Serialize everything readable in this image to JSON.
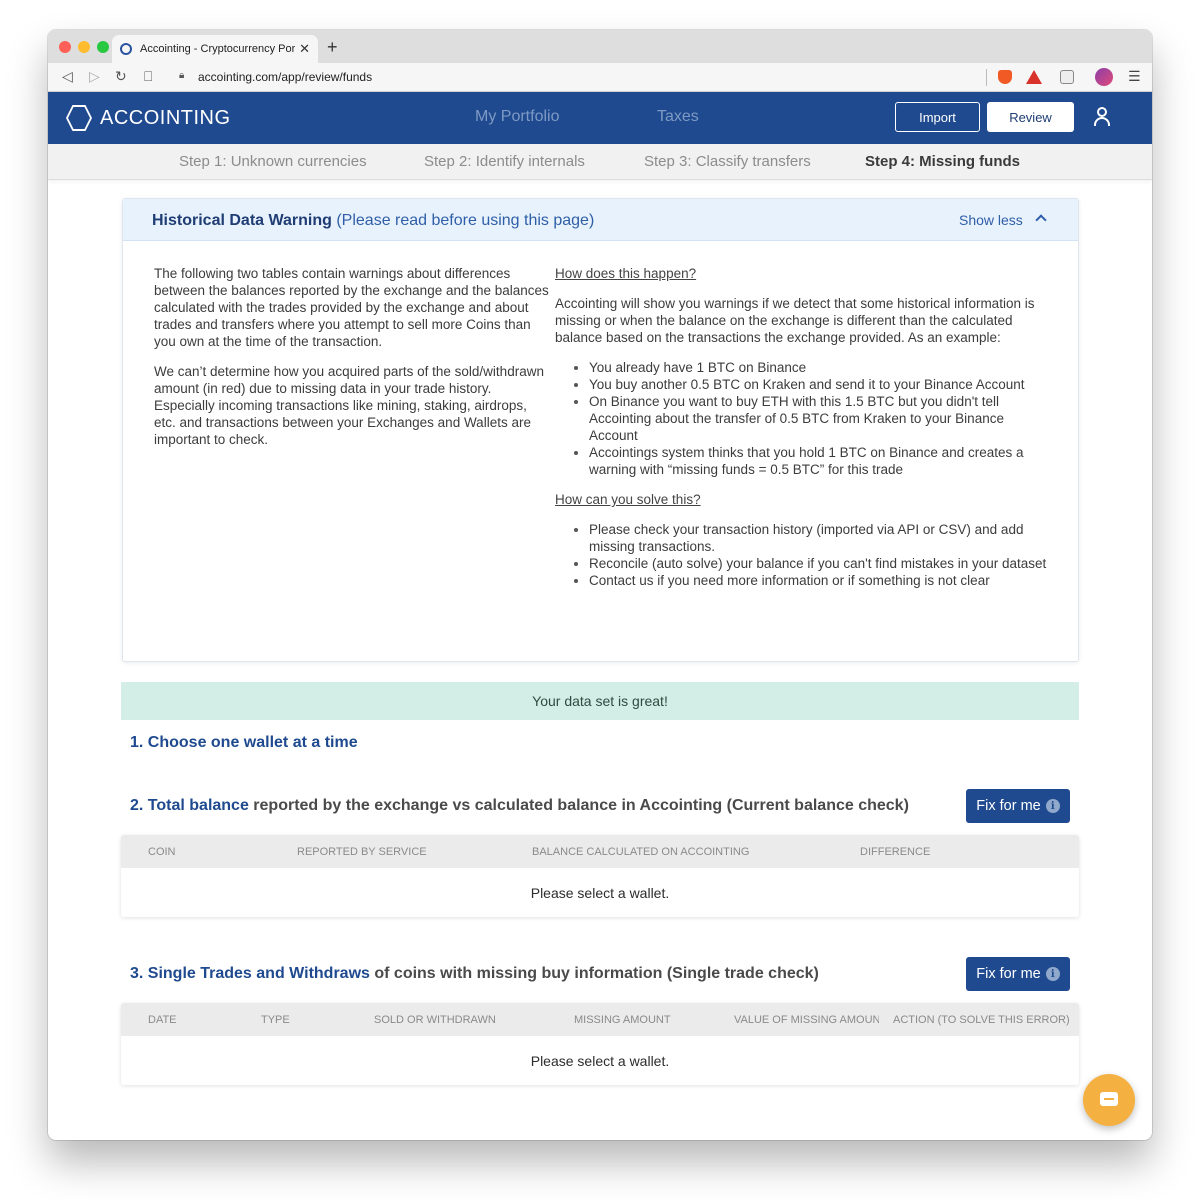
{
  "browser": {
    "tab_title": "Accointing - Cryptocurrency Portfolio",
    "new_tab": "+",
    "url": "accointing.com/app/review/funds"
  },
  "header": {
    "logo_text": "ACCOINTING",
    "nav": [
      "My Portfolio",
      "Taxes"
    ],
    "import_label": "Import",
    "review_label": "Review"
  },
  "steps": [
    "Step 1: Unknown currencies",
    "Step 2: Identify internals",
    "Step 3: Classify transfers",
    "Step 4: Missing funds"
  ],
  "warning": {
    "title": "Historical Data Warning",
    "subtitle": "(Please read before using this page)",
    "toggle_label": "Show less",
    "left_paragraphs": [
      "The following two tables contain warnings about differences between the balances reported by the exchange and the balances calculated with the trades provided by the exchange and about trades and transfers where you attempt to sell more Coins than you own at the time of the transaction.",
      "We can’t determine how you acquired parts of the sold/withdrawn amount (in red) due to missing data in your trade history. Especially incoming transactions like mining, staking, airdrops, etc. and transactions between your Exchanges and Wallets are important to check."
    ],
    "how_heading": "How does this happen?",
    "how_intro": "Accointing will show you warnings if we detect that some historical information is missing or when the balance on the exchange is different than the calculated balance based on the transactions the exchange provided. As an example:",
    "how_bullets": [
      "You already have 1 BTC on Binance",
      "You buy another 0.5 BTC on Kraken and send it to your Binance Account",
      "On Binance you want to buy ETH with this 1.5 BTC but you didn't tell Accointing about the transfer of 0.5 BTC from Kraken to your Binance Account",
      "Accointings system thinks that you hold 1 BTC on Binance and creates a warning with “missing funds = 0.5 BTC” for this trade"
    ],
    "solve_heading": "How can you solve this?",
    "solve_bullets": [
      "Please check your transaction history (imported via API or CSV) and add missing transactions.",
      "Reconcile (auto solve) your balance if you can't find mistakes in your dataset",
      "Contact us if you need more information or if something is not clear"
    ]
  },
  "status_message": "Your data set is great!",
  "section1": {
    "title": "1. Choose one wallet at a time"
  },
  "section2": {
    "title_blue": "2. Total balance",
    "title_rest": " reported by the exchange vs calculated balance in Accointing (Current balance check)",
    "fix_label": "Fix for me",
    "columns": [
      "COIN",
      "REPORTED BY SERVICE",
      "BALANCE CALCULATED ON ACCOINTING",
      "DIFFERENCE"
    ],
    "empty_message": "Please select a wallet."
  },
  "section3": {
    "title_blue": "3. Single Trades and Withdraws",
    "title_rest": " of coins with missing buy information (Single trade check)",
    "fix_label": "Fix for me",
    "columns": [
      "DATE",
      "TYPE",
      "SOLD OR WITHDRAWN",
      "MISSING AMOUNT",
      "VALUE OF MISSING AMOUNT",
      "ACTION (TO SOLVE THIS ERROR)"
    ],
    "empty_message": "Please select a wallet."
  },
  "icons": {
    "info": "i"
  },
  "colors": {
    "brand_blue": "#1f4a8f",
    "success_bg": "#d3eee6",
    "chat_orange": "#f5b042"
  }
}
